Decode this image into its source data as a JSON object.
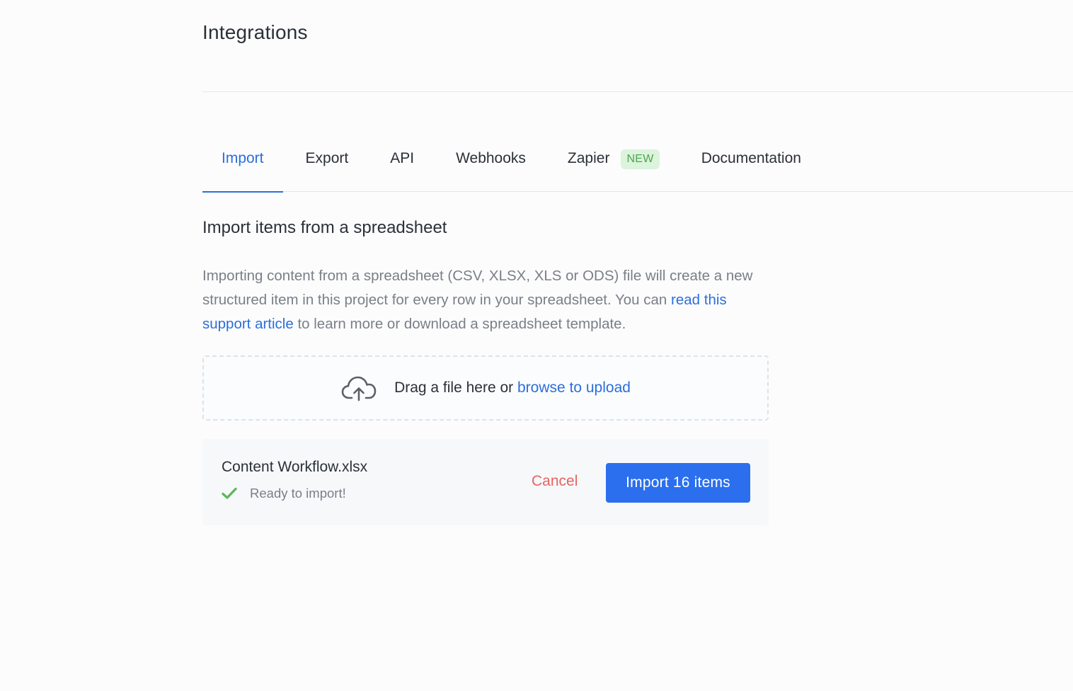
{
  "page": {
    "title": "Integrations"
  },
  "tabs": [
    {
      "label": "Import",
      "active": true
    },
    {
      "label": "Export",
      "active": false
    },
    {
      "label": "API",
      "active": false
    },
    {
      "label": "Webhooks",
      "active": false
    },
    {
      "label": "Zapier",
      "active": false,
      "badge": "NEW"
    },
    {
      "label": "Documentation",
      "active": false
    }
  ],
  "import_section": {
    "title": "Import items from a spreadsheet",
    "description_before": "Importing content from a spreadsheet (CSV, XLSX, XLS or ODS) file will create a new structured item in this project for every row in your spreadsheet. You can ",
    "description_link": "read this support article",
    "description_after": " to learn more or download a spreadsheet template."
  },
  "dropzone": {
    "icon": "cloud-upload-icon",
    "text": "Drag a file here or ",
    "link": "browse to upload"
  },
  "file": {
    "name": "Content Workflow.xlsx",
    "status_icon": "check-icon",
    "status": "Ready to import!",
    "cancel_label": "Cancel",
    "import_label": "Import 16 items"
  },
  "colors": {
    "accent": "#2b6fdb",
    "primary_button": "#2b6fee",
    "cancel": "#e4665f",
    "success": "#5cb85c",
    "badge_bg": "#dcf3dc",
    "badge_text": "#4da64d"
  }
}
